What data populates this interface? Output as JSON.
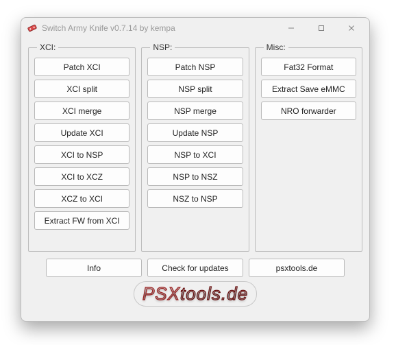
{
  "window": {
    "title": "Switch Army Knife v0.7.14 by kempa"
  },
  "groups": {
    "xci": {
      "legend": "XCI:",
      "buttons": [
        "Patch XCI",
        "XCI split",
        "XCI merge",
        "Update XCI",
        "XCI to NSP",
        "XCI to XCZ",
        "XCZ to XCI",
        "Extract FW from XCI"
      ]
    },
    "nsp": {
      "legend": "NSP:",
      "buttons": [
        "Patch NSP",
        "NSP split",
        "NSP merge",
        "Update NSP",
        "NSP to XCI",
        "NSP to NSZ",
        "NSZ to NSP"
      ]
    },
    "misc": {
      "legend": "Misc:",
      "buttons": [
        "Fat32 Format",
        "Extract Save eMMC",
        "NRO forwarder"
      ]
    }
  },
  "bottom": {
    "info": "Info",
    "check_updates": "Check for updates",
    "site": "psxtools.de"
  },
  "logo": {
    "text_a": "PSX",
    "text_b": "tools.de"
  }
}
